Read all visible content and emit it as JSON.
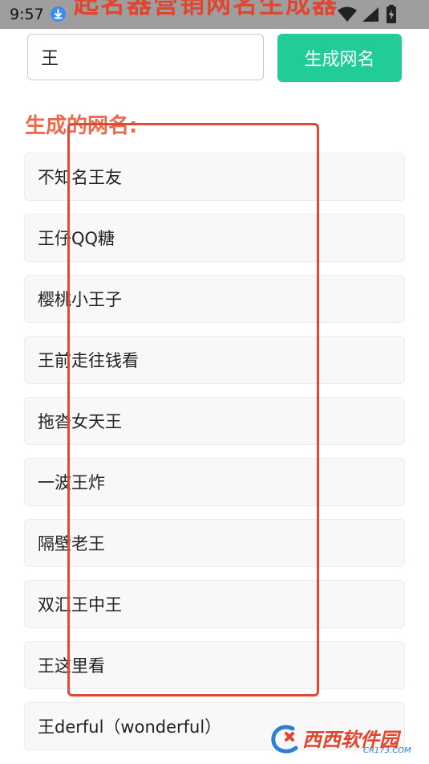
{
  "status_bar": {
    "time": "9:57",
    "banner_title": "起名器营销网名生成器",
    "icons": [
      "download-icon",
      "wifi-icon",
      "signal-icon",
      "battery-icon"
    ]
  },
  "search": {
    "value": "王",
    "placeholder": ""
  },
  "generate_button": {
    "label": "生成网名"
  },
  "results": {
    "heading": "生成的网名:",
    "items": [
      "不知名王友",
      "王仔QQ糖",
      "樱桃小王子",
      "王前走往钱看",
      "拖沓女天王",
      "一波王炸",
      "隔壁老王",
      "双汇王中王",
      "王这里看",
      "王derful（wonderful）"
    ]
  },
  "watermark": {
    "main": "西西软件园",
    "sub": "CR173.COM"
  },
  "colors": {
    "accent_green": "#22cc99",
    "heading_orange": "#ee6a4e",
    "highlight_red": "#e04a35",
    "status_bar_gray": "#9e9e9e"
  }
}
